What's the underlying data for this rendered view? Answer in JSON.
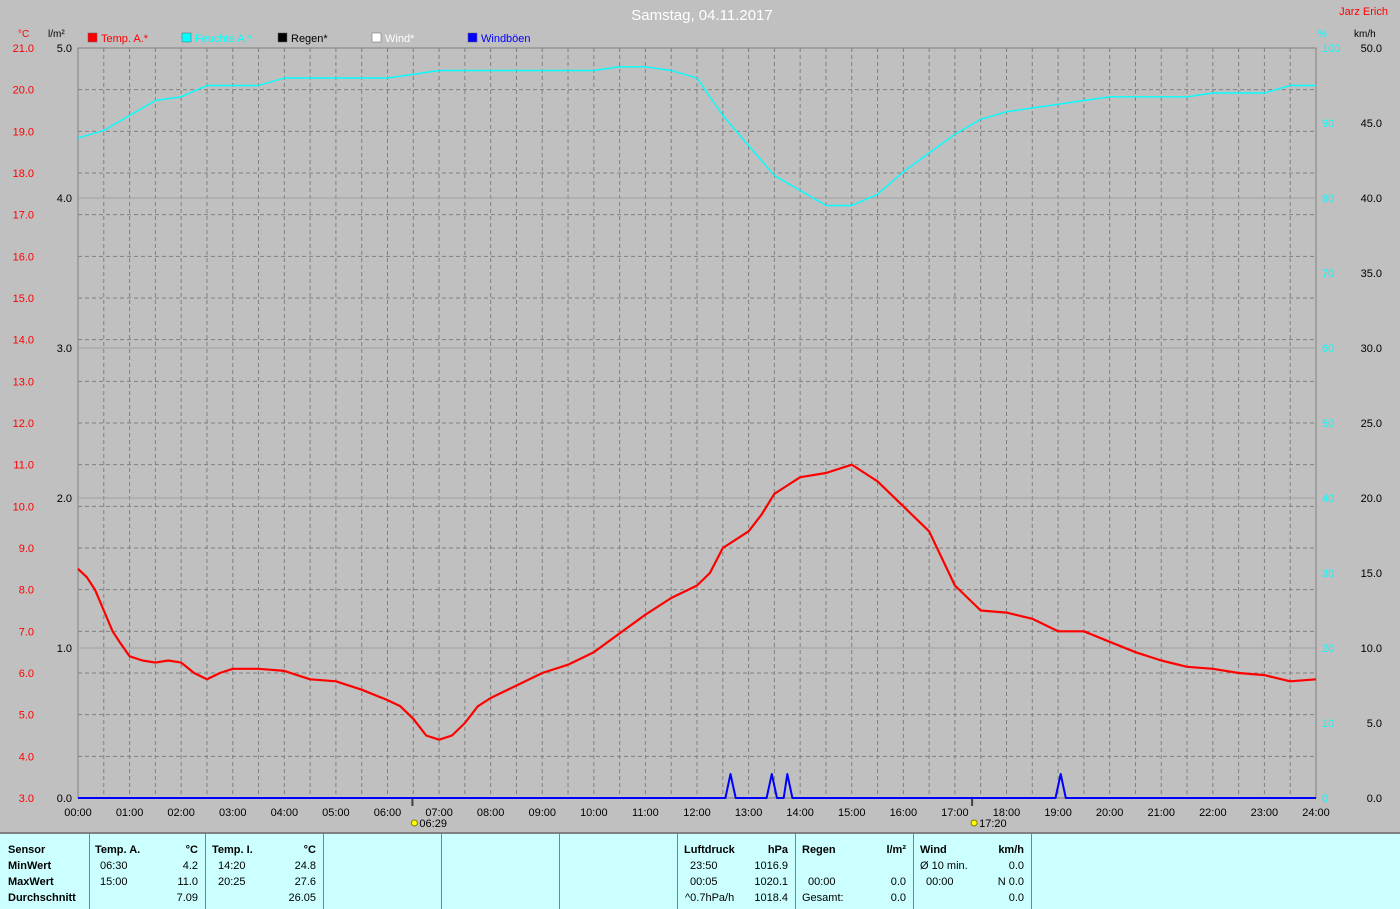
{
  "title": "Samstag, 04.11.2017",
  "author": "Jarz Erich",
  "legend": [
    {
      "label": "Temp. A.*",
      "color": "#ff0000"
    },
    {
      "label": "Feuchte A.*",
      "color": "#00ffff"
    },
    {
      "label": "Regen*",
      "color": "#000000"
    },
    {
      "label": "Wind*",
      "color": "#ffffff"
    },
    {
      "label": "Windböen",
      "color": "#0000ff"
    }
  ],
  "axes": {
    "left_temp_unit": "°C",
    "left_rain_unit": "l/m²",
    "right_hum_unit": "%",
    "right_wind_unit": "km/h",
    "temp_ticks": [
      "3.0",
      "4.0",
      "5.0",
      "6.0",
      "7.0",
      "8.0",
      "9.0",
      "10.0",
      "11.0",
      "12.0",
      "13.0",
      "14.0",
      "15.0",
      "16.0",
      "17.0",
      "18.0",
      "19.0",
      "20.0",
      "21.0"
    ],
    "rain_ticks": [
      "0.0",
      "1.0",
      "2.0",
      "3.0",
      "4.0",
      "5.0"
    ],
    "hum_ticks": [
      "0",
      "10",
      "20",
      "30",
      "40",
      "50",
      "60",
      "70",
      "80",
      "90",
      "100"
    ],
    "wind_ticks": [
      "0.0",
      "5.0",
      "10.0",
      "15.0",
      "20.0",
      "25.0",
      "30.0",
      "35.0",
      "40.0",
      "45.0",
      "50.0"
    ],
    "x_ticks": [
      "00:00",
      "01:00",
      "02:00",
      "03:00",
      "04:00",
      "05:00",
      "06:00",
      "07:00",
      "08:00",
      "09:00",
      "10:00",
      "11:00",
      "12:00",
      "13:00",
      "14:00",
      "15:00",
      "16:00",
      "17:00",
      "18:00",
      "19:00",
      "20:00",
      "21:00",
      "22:00",
      "23:00",
      "24:00"
    ],
    "sunrise": "06:29",
    "sunset": "17:20"
  },
  "chart_data": {
    "type": "line",
    "x_range": [
      0,
      24
    ],
    "series": [
      {
        "name": "Temp. A.*",
        "color": "#ff0000",
        "axis": "temp",
        "ylim": [
          3,
          21
        ],
        "x": [
          0,
          0.17,
          0.33,
          0.5,
          0.67,
          0.83,
          1,
          1.25,
          1.5,
          1.75,
          2,
          2.25,
          2.5,
          2.75,
          3,
          3.5,
          4,
          4.5,
          5,
          5.5,
          6,
          6.25,
          6.5,
          6.75,
          7,
          7.25,
          7.5,
          7.75,
          8,
          8.5,
          9,
          9.5,
          10,
          10.5,
          11,
          11.5,
          12,
          12.25,
          12.5,
          12.75,
          13,
          13.25,
          13.5,
          13.75,
          14,
          14.5,
          15,
          15.25,
          15.5,
          16,
          16.5,
          17,
          17.5,
          18,
          18.5,
          19,
          19.5,
          20,
          20.5,
          21,
          21.5,
          22,
          22.5,
          23,
          23.5,
          24
        ],
        "y": [
          8.5,
          8.3,
          8.0,
          7.5,
          7.0,
          6.7,
          6.4,
          6.3,
          6.25,
          6.3,
          6.25,
          6.0,
          5.85,
          6.0,
          6.1,
          6.1,
          6.05,
          5.85,
          5.8,
          5.6,
          5.35,
          5.2,
          4.9,
          4.5,
          4.4,
          4.5,
          4.8,
          5.2,
          5.4,
          5.7,
          6.0,
          6.2,
          6.5,
          6.95,
          7.4,
          7.8,
          8.1,
          8.4,
          9.0,
          9.2,
          9.4,
          9.8,
          10.3,
          10.5,
          10.7,
          10.8,
          11.0,
          10.8,
          10.6,
          10.0,
          9.4,
          8.1,
          7.5,
          7.45,
          7.3,
          7.0,
          7.0,
          6.75,
          6.5,
          6.3,
          6.15,
          6.1,
          6.0,
          5.95,
          5.8,
          5.85
        ]
      },
      {
        "name": "Feuchte A.*",
        "color": "#00ffff",
        "axis": "hum",
        "ylim": [
          0,
          100
        ],
        "x": [
          0,
          0.5,
          1,
          1.5,
          2,
          2.5,
          3,
          3.5,
          4,
          4.5,
          5,
          5.5,
          6,
          6.5,
          7,
          7.5,
          8,
          8.5,
          9,
          9.5,
          10,
          10.5,
          11,
          11.5,
          12,
          12.5,
          13,
          13.5,
          14,
          14.5,
          15,
          15.5,
          16,
          16.5,
          17,
          17.5,
          18,
          18.5,
          19,
          19.5,
          20,
          20.5,
          21,
          21.5,
          22,
          22.5,
          23,
          23.5,
          24
        ],
        "y": [
          88,
          89,
          91,
          93,
          93.5,
          95,
          95,
          95,
          96,
          96,
          96,
          96,
          96,
          96.5,
          97,
          97,
          97,
          97,
          97,
          97,
          97,
          97.5,
          97.5,
          97,
          96,
          91,
          87,
          83,
          81,
          79,
          79,
          80.5,
          83.5,
          86,
          88.5,
          90.5,
          91.5,
          92,
          92.5,
          93,
          93.5,
          93.5,
          93.5,
          93.5,
          94,
          94,
          94,
          95,
          95
        ]
      },
      {
        "name": "Windböen",
        "color": "#0000ff",
        "axis": "wind",
        "ylim": [
          0,
          50
        ],
        "x": [
          0,
          12.5,
          12.55,
          12.65,
          12.75,
          12.8,
          13.3,
          13.35,
          13.45,
          13.55,
          13.6,
          13.62,
          13.68,
          13.75,
          13.85,
          13.9,
          18.9,
          18.95,
          19.05,
          19.15,
          19.2,
          24
        ],
        "y": [
          0,
          0,
          0,
          1.6,
          0,
          0,
          0,
          0,
          1.6,
          0,
          0,
          0,
          0,
          1.6,
          0,
          0,
          0,
          0,
          1.6,
          0,
          0,
          0
        ]
      }
    ]
  },
  "table": {
    "sensor": {
      "header": "Sensor",
      "rows": [
        "MinWert",
        "MaxWert",
        "Durchschnitt"
      ]
    },
    "temp_a": {
      "header": "Temp. A.",
      "unit": "°C",
      "times": [
        "06:30",
        "15:00",
        ""
      ],
      "values": [
        "4.2",
        "11.0",
        "7.09"
      ]
    },
    "temp_i": {
      "header": "Temp. I.",
      "unit": "°C",
      "times": [
        "14:20",
        "20:25",
        ""
      ],
      "values": [
        "24.8",
        "27.6",
        "26.05"
      ]
    },
    "pressure": {
      "header": "Luftdruck",
      "unit": "hPa",
      "times": [
        "23:50",
        "00:05",
        "^0.7hPa/h"
      ],
      "values": [
        "1016.9",
        "1020.1",
        "1018.4"
      ]
    },
    "rain": {
      "header": "Regen",
      "unit": "l/m²",
      "times": [
        "",
        "00:00",
        "Gesamt:"
      ],
      "values": [
        "",
        "0.0",
        "0.0"
      ]
    },
    "wind": {
      "header": "Wind",
      "unit": "km/h",
      "times": [
        "Ø 10 min.",
        "00:00",
        ""
      ],
      "values": [
        "0.0",
        "N 0.0",
        "0.0"
      ]
    }
  }
}
